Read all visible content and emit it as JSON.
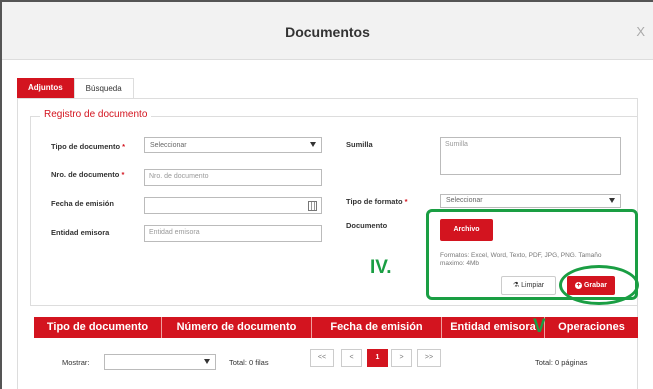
{
  "modal": {
    "title": "Documentos",
    "close": "X"
  },
  "tabs": [
    {
      "label": "Adjuntos",
      "active": true
    },
    {
      "label": "Búsqueda",
      "active": false
    }
  ],
  "section": {
    "legend": "Registro de documento"
  },
  "form": {
    "tipo_documento": {
      "label": "Tipo de documento",
      "required": "*",
      "value": "Seleccionar"
    },
    "nro_documento": {
      "label": "Nro. de documento",
      "required": "*",
      "placeholder": "Nro. de documento"
    },
    "fecha_emision": {
      "label": "Fecha de emisión",
      "value": ""
    },
    "entidad_emisora": {
      "label": "Entidad emisora",
      "placeholder": "Entidad emisora"
    },
    "sumilla": {
      "label": "Sumilla",
      "placeholder": "Sumilla"
    },
    "tipo_formato": {
      "label": "Tipo de formato",
      "required": "*",
      "value": "Seleccionar"
    },
    "documento": {
      "label": "Documento",
      "button": "Archivo",
      "note": "Formatos: Excel, Word, Texto, PDF, JPG, PNG. Tamaño maximo: 4Mb"
    }
  },
  "actions": {
    "limpiar": "Limpiar",
    "grabar": "Grabar"
  },
  "annotations": {
    "iv": "IV.",
    "v": "V"
  },
  "table": {
    "columns": [
      "Tipo de documento",
      "Número de documento",
      "Fecha de emisión",
      "Entidad emisora",
      "Operaciones"
    ]
  },
  "pager": {
    "mostrar_label": "Mostrar:",
    "total_filas": "Total: 0 filas",
    "buttons": [
      "<<",
      "<",
      "1",
      ">",
      ">>"
    ],
    "current_page": "1",
    "total_paginas": "Total: 0 páginas"
  },
  "colors": {
    "brand": "#d3141f",
    "annotation": "#1a9e43"
  }
}
